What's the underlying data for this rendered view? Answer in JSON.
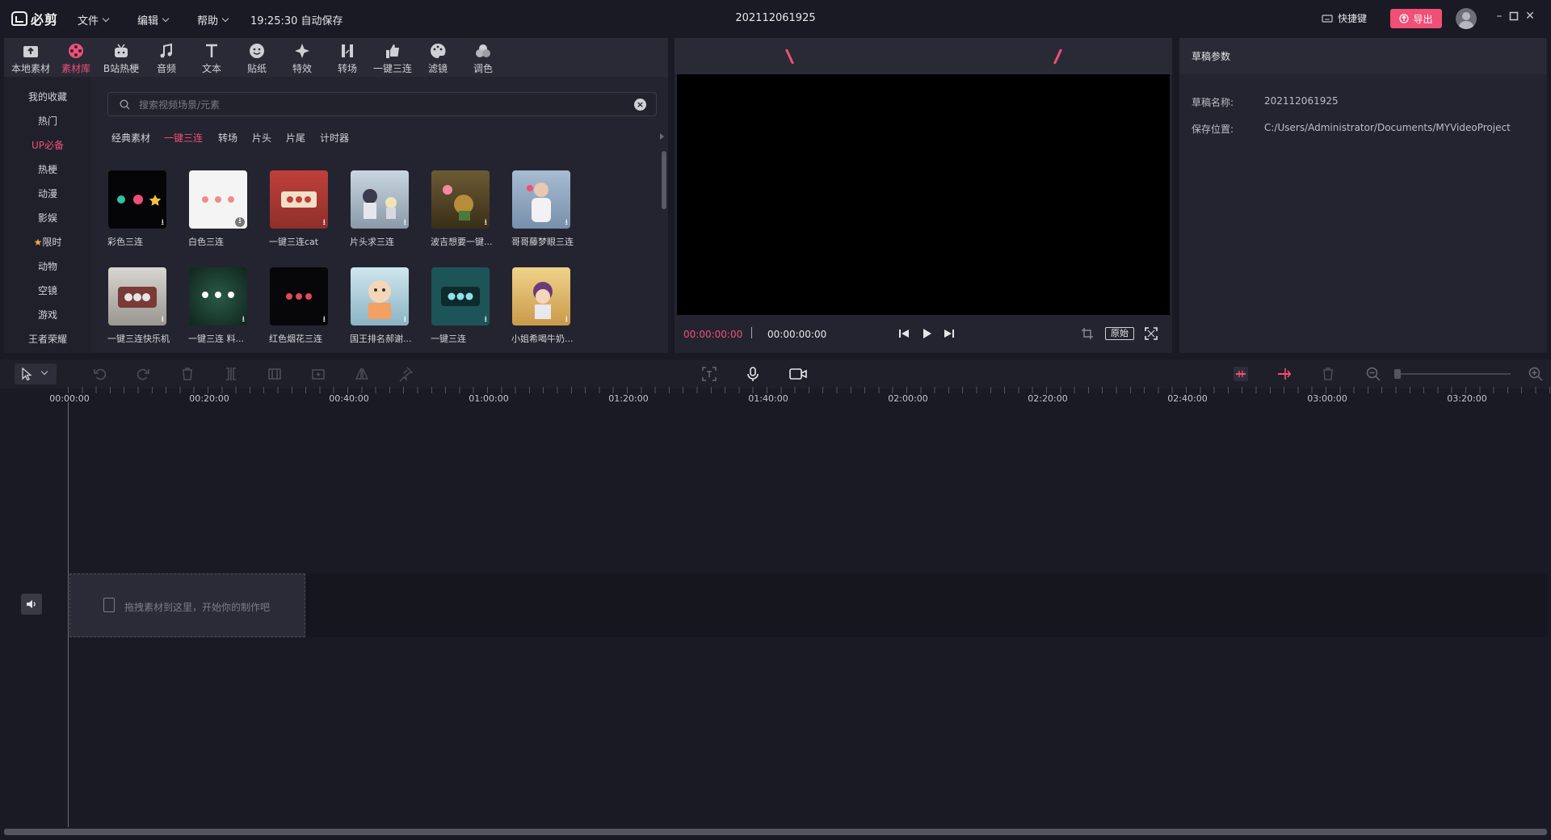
{
  "app": {
    "logo_text": "必剪",
    "menus": [
      "文件",
      "编辑",
      "帮助"
    ],
    "autosave": "19:25:30 自动保存",
    "project_title": "202112061925",
    "shortcut_label": "快捷键",
    "export_label": "导出",
    "accent_color": "#f04f78"
  },
  "tool_tabs": [
    {
      "label": "本地素材",
      "icon": "upload-folder-icon"
    },
    {
      "label": "素材库",
      "icon": "film-reel-icon",
      "active": true
    },
    {
      "label": "B站热梗",
      "icon": "bilibili-tv-icon"
    },
    {
      "label": "音频",
      "icon": "music-note-icon"
    },
    {
      "label": "文本",
      "icon": "text-t-icon"
    },
    {
      "label": "贴纸",
      "icon": "sticker-face-icon"
    },
    {
      "label": "特效",
      "icon": "sparkle-star-icon"
    },
    {
      "label": "转场",
      "icon": "transition-bars-icon"
    },
    {
      "label": "一键三连",
      "icon": "thumbs-up-icon"
    },
    {
      "label": "滤镜",
      "icon": "palette-icon"
    },
    {
      "label": "调色",
      "icon": "color-circles-icon"
    }
  ],
  "categories": [
    {
      "label": "我的收藏"
    },
    {
      "label": "热门"
    },
    {
      "label": "UP必备",
      "active": true
    },
    {
      "label": "热梗"
    },
    {
      "label": "动漫"
    },
    {
      "label": "影娱"
    },
    {
      "label": "限时",
      "star": "★"
    },
    {
      "label": "动物"
    },
    {
      "label": "空镜"
    },
    {
      "label": "游戏"
    },
    {
      "label": "王者荣耀"
    }
  ],
  "search": {
    "placeholder": "搜索视频场景/元素"
  },
  "sub_tabs": [
    {
      "label": "经典素材"
    },
    {
      "label": "一键三连",
      "active": true
    },
    {
      "label": "转场"
    },
    {
      "label": "片头"
    },
    {
      "label": "片尾"
    },
    {
      "label": "计时器"
    }
  ],
  "library_items": [
    {
      "label": "彩色三连",
      "bg": "#050507"
    },
    {
      "label": "白色三连",
      "bg": "#f4f4f4"
    },
    {
      "label": "一键三连cat",
      "bg": "#c0403a"
    },
    {
      "label": "片头求三连",
      "bg": "#9aa9b8"
    },
    {
      "label": "波吉想要一键...",
      "bg": "#5a4a2a"
    },
    {
      "label": "哥哥藤梦眼三连",
      "bg": "#8fa6bf"
    },
    {
      "label": "一键三连快乐机",
      "bg": "#c9c6c0"
    },
    {
      "label": "一键三连 料...",
      "bg": "#1f3a30"
    },
    {
      "label": "红色烟花三连",
      "bg": "#070608"
    },
    {
      "label": "国王排名郝谢...",
      "bg": "#b8d6e0"
    },
    {
      "label": "一键三连",
      "bg": "#1d5458"
    },
    {
      "label": "小姐希喝牛奶...",
      "bg": "#e5c27a"
    }
  ],
  "preview": {
    "time_current": "00:00:00:00",
    "time_total": "00:00:00:00",
    "ratio_label": "原始"
  },
  "params": {
    "header": "草稿参数",
    "rows": [
      {
        "key": "草稿名称:",
        "value": "202112061925"
      },
      {
        "key": "保存位置:",
        "value": "C:/Users/Administrator/Documents/MYVideoProject"
      }
    ]
  },
  "timeline": {
    "ruler_labels": [
      "00:00:00",
      "00:20:00",
      "00:40:00",
      "01:00:00",
      "01:20:00",
      "01:40:00",
      "02:00:00",
      "02:20:00",
      "02:40:00",
      "03:00:00",
      "03:20:00"
    ],
    "drop_hint": "拖拽素材到这里，开始你的制作吧"
  }
}
